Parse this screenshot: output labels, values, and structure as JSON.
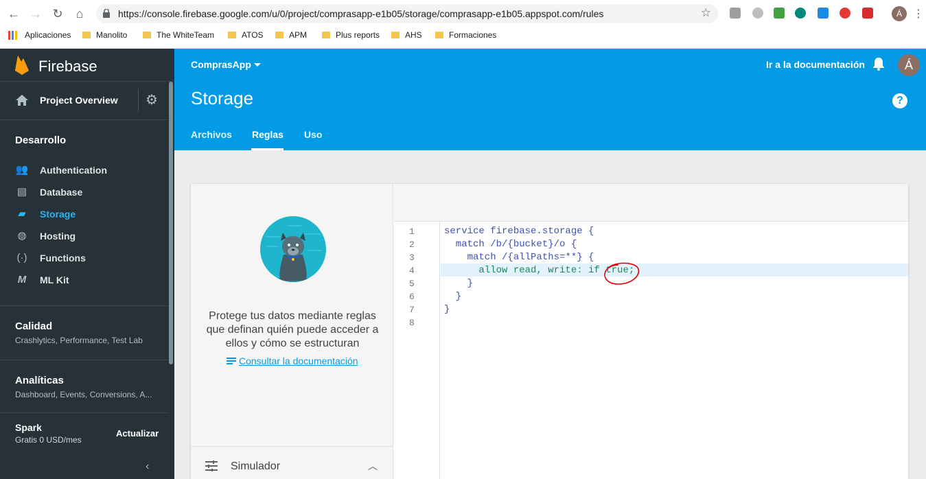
{
  "browser": {
    "url": "https://console.firebase.google.com/u/0/project/comprasapp-e1b05/storage/comprasapp-e1b05.appspot.com/rules",
    "profile_initial": "Á",
    "bookmarks": [
      "Aplicaciones",
      "Manolito",
      "The WhiteTeam",
      "ATOS",
      "APM",
      "Plus reports",
      "AHS",
      "Formaciones"
    ]
  },
  "sidebar": {
    "brand": "Firebase",
    "overview": "Project Overview",
    "sections": {
      "develop": "Desarrollo",
      "quality": "Calidad",
      "quality_sub": "Crashlytics, Performance, Test Lab",
      "analytics": "Analíticas",
      "analytics_sub": "Dashboard, Events, Conversions, A..."
    },
    "items": [
      {
        "label": "Authentication",
        "icon": "people-icon"
      },
      {
        "label": "Database",
        "icon": "database-icon"
      },
      {
        "label": "Storage",
        "icon": "storage-icon",
        "active": true
      },
      {
        "label": "Hosting",
        "icon": "globe-icon"
      },
      {
        "label": "Functions",
        "icon": "functions-icon"
      },
      {
        "label": "ML Kit",
        "icon": "mlkit-icon"
      }
    ],
    "plan": {
      "name": "Spark",
      "price": "Gratis 0 USD/mes",
      "upgrade": "Actualizar"
    }
  },
  "header": {
    "project": "ComprasApp",
    "docs_link": "Ir a la documentación",
    "avatar_initial": "Á",
    "title": "Storage",
    "help": "?",
    "tabs": [
      "Archivos",
      "Reglas",
      "Uso"
    ],
    "active_tab": "Reglas"
  },
  "left_panel": {
    "text": "Protege tus datos mediante reglas que definan quién puede acceder a ellos y cómo se estructuran",
    "doc_link": "Consultar la documentación",
    "simulator": "Simulador"
  },
  "editor": {
    "line_numbers": [
      "1",
      "2",
      "3",
      "4",
      "5",
      "6",
      "7",
      "8"
    ],
    "lines": [
      "service firebase.storage {",
      "  match /b/{bucket}/o {",
      "    match /{allPaths=**} {",
      "      allow read, write: if true;",
      "    }",
      "  }",
      "}",
      ""
    ],
    "highlighted_line": 4
  },
  "colors": {
    "primary": "#039be5",
    "sidebar": "#263238",
    "active": "#29b6f6",
    "annotation": "#e00000"
  }
}
